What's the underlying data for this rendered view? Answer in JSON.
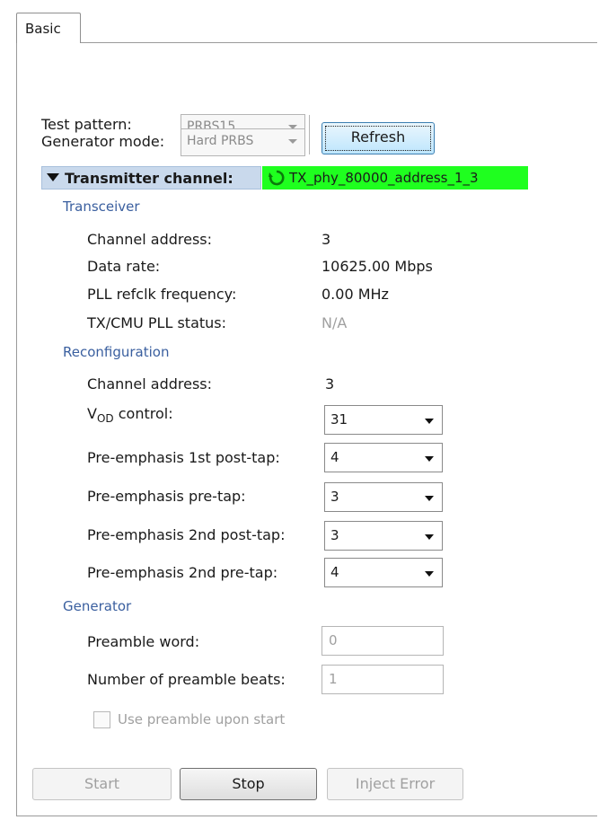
{
  "tab": {
    "label": "Basic"
  },
  "test_pattern": {
    "label": "Test pattern:",
    "value": "PRBS15"
  },
  "generator_mode": {
    "label": "Generator mode:",
    "value": "Hard PRBS"
  },
  "refresh_button": {
    "label": "Refresh"
  },
  "transmitter": {
    "header": "Transmitter channel:",
    "channel_name": "TX_phy_80000_address_1_3",
    "tag_color": "#1fff1f"
  },
  "transceiver": {
    "section": "Transceiver",
    "rows": [
      {
        "label": "Channel address:",
        "value": "3"
      },
      {
        "label": "Data rate:",
        "value": "10625.00 Mbps"
      },
      {
        "label": "PLL refclk frequency:",
        "value": "0.00 MHz"
      },
      {
        "label": "TX/CMU PLL status:",
        "value": "N/A"
      }
    ]
  },
  "reconfiguration": {
    "section": "Reconfiguration",
    "channel_address": {
      "label": "Channel address:",
      "value": "3"
    },
    "vod": {
      "label_main": "V",
      "label_sub": "OD",
      "label_rest": " control:",
      "value": "31"
    },
    "pre_post1": {
      "label": "Pre-emphasis 1st post-tap:",
      "value": "4"
    },
    "pre_pre": {
      "label": "Pre-emphasis pre-tap:",
      "value": "3"
    },
    "pre_post2": {
      "label": "Pre-emphasis 2nd post-tap:",
      "value": "3"
    },
    "pre_pre2": {
      "label": "Pre-emphasis 2nd pre-tap:",
      "value": "4"
    }
  },
  "generator": {
    "section": "Generator",
    "preamble_word": {
      "label": "Preamble word:",
      "value": "0"
    },
    "preamble_beats": {
      "label": "Number of preamble beats:",
      "value": "1"
    },
    "use_preamble": {
      "label": "Use preamble upon start",
      "checked": false
    }
  },
  "buttons": {
    "start": "Start",
    "stop": "Stop",
    "inject": "Inject Error"
  }
}
